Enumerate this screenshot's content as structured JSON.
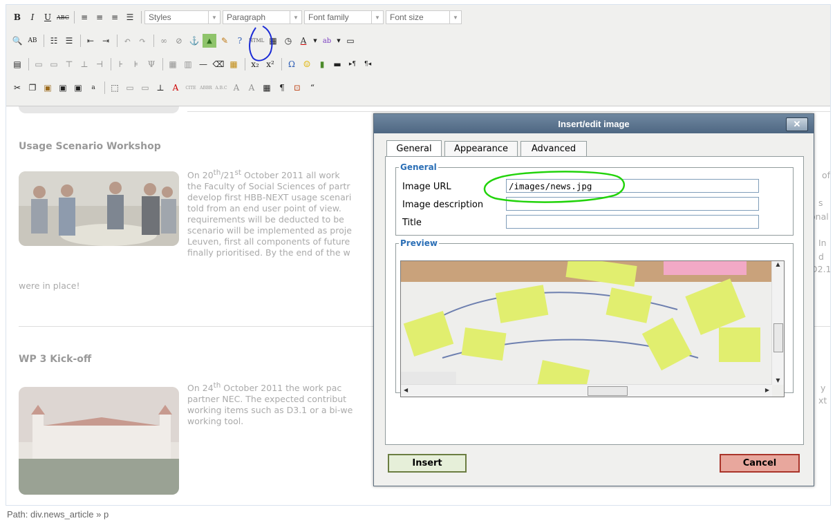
{
  "toolbar": {
    "styles_placeholder": "Styles",
    "format_value": "Paragraph",
    "font_family_placeholder": "Font family",
    "font_size_placeholder": "Font size",
    "html_label": "HTML"
  },
  "content": {
    "article1": {
      "heading": "Usage Scenario Workshop",
      "lines": [
        "On 20th/21st October 2011 all work",
        "the Faculty of Social Sciences of partr",
        "develop first HBB-NEXT usage scenari",
        "told from an end user point of view.",
        "requirements will be deducted to be",
        "scenario will be implemented as proje",
        "Leuven, first all components of future",
        "finally prioritised. By the end of the w"
      ],
      "overflow_line": "were in place!",
      "right_fragments": [
        "of",
        "s",
        "onal",
        "In",
        "d",
        "D2.1"
      ]
    },
    "article2": {
      "heading": "WP 3 Kick-off",
      "lines": [
        "On 24th October 2011 the work pac",
        "partner NEC. The expected contribut",
        "working items such as D3.1 or a bi-we",
        "working tool."
      ],
      "right_fragments": [
        "y",
        "xt"
      ]
    }
  },
  "statusbar": {
    "path": "Path: div.news_article » p"
  },
  "dialog": {
    "title": "Insert/edit image",
    "close_label": "✕",
    "tabs": [
      "General",
      "Appearance",
      "Advanced"
    ],
    "general_legend": "General",
    "preview_legend": "Preview",
    "fields": {
      "image_url_label": "Image URL",
      "image_url_value": "/images/news.jpg",
      "description_label": "Image description",
      "description_value": "",
      "title_label": "Title",
      "title_value": ""
    },
    "insert_label": "Insert",
    "cancel_label": "Cancel"
  },
  "colors": {
    "dialog_title_bg": "#5b7490",
    "legend": "#2b6fb6",
    "insert_bg": "#e6efd9",
    "cancel_bg": "#e8a79d",
    "annotation_blue": "#1b2bd6",
    "annotation_green": "#22d30b"
  }
}
